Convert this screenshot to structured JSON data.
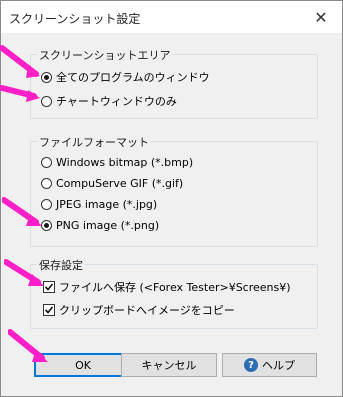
{
  "dialog": {
    "title": "スクリーンショット設定",
    "close_glyph": "✕"
  },
  "area_group": {
    "legend": "スクリーンショットエリア",
    "options": [
      {
        "label": "全てのプログラムのウィンドウ",
        "selected": true
      },
      {
        "label": "チャートウィンドウのみ",
        "selected": false
      }
    ]
  },
  "format_group": {
    "legend": "ファイルフォーマット",
    "options": [
      {
        "label": "Windows bitmap (*.bmp)",
        "selected": false
      },
      {
        "label": "CompuServe GIF (*.gif)",
        "selected": false
      },
      {
        "label": "JPEG image (*.jpg)",
        "selected": false
      },
      {
        "label": "PNG image (*.png)",
        "selected": true
      }
    ]
  },
  "save_group": {
    "legend": "保存設定",
    "options": [
      {
        "label": "ファイルへ保存 (<Forex Tester>¥Screens¥)",
        "checked": true
      },
      {
        "label": "クリップボードへイメージをコピー",
        "checked": true
      }
    ]
  },
  "buttons": {
    "ok": "OK",
    "cancel": "キャンセル",
    "help": "ヘルプ",
    "help_icon_glyph": "?"
  },
  "colors": {
    "annotation_arrow": "#ff1fc8",
    "default_button_border": "#0078d7",
    "help_icon": "#2d6bb5"
  }
}
